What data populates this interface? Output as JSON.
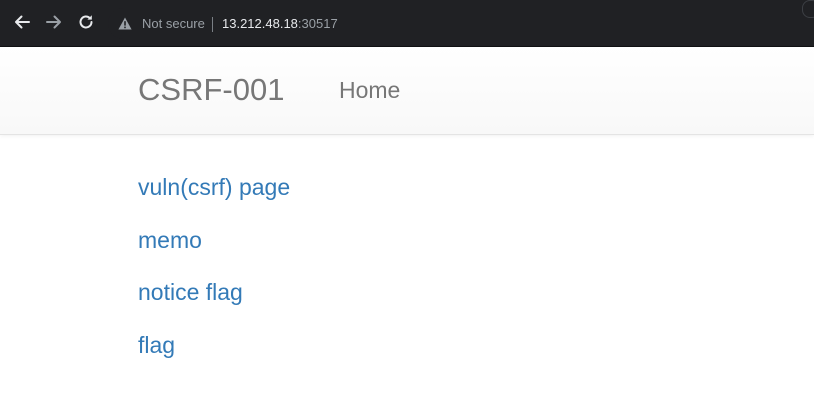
{
  "browser": {
    "security_label": "Not secure",
    "host": "13.212.48.18",
    "port": ":30517",
    "icons": {
      "back": "arrow-left-icon",
      "forward": "arrow-right-icon",
      "reload": "reload-icon",
      "security": "warning-triangle-icon"
    }
  },
  "navbar": {
    "brand": "CSRF-001",
    "home_label": "Home"
  },
  "main": {
    "links": [
      {
        "label": "vuln(csrf) page"
      },
      {
        "label": "memo"
      },
      {
        "label": "notice flag"
      },
      {
        "label": "flag"
      }
    ]
  },
  "colors": {
    "link": "#337ab7",
    "navbar_text": "#777777",
    "browser_bg": "#202124"
  }
}
